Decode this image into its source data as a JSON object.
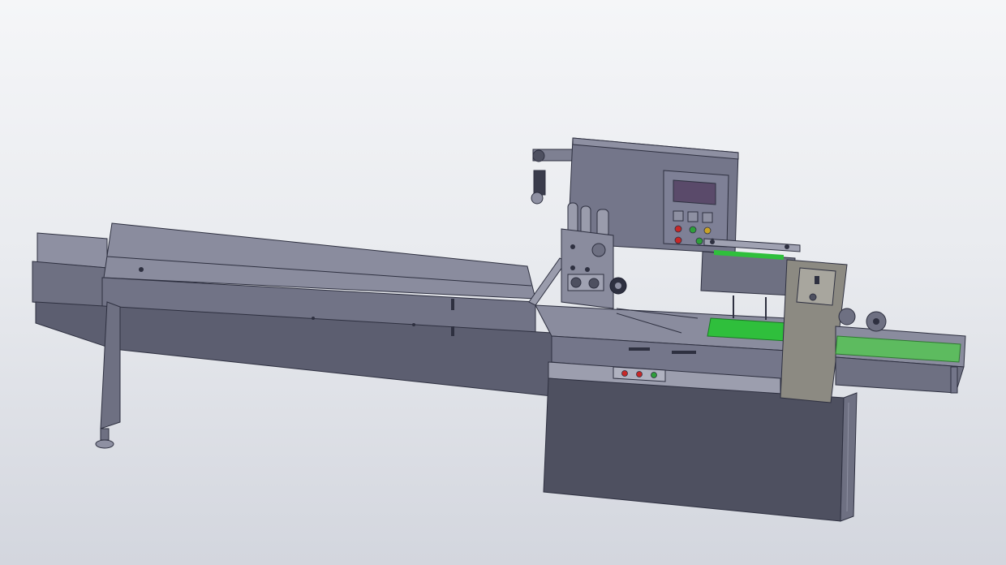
{
  "scene": {
    "subject": "",
    "colors": {
      "background_top": "#f5f6f8",
      "background_bottom": "#d3d6de",
      "body_dark": "#4e5060",
      "body_mid": "#6e7082",
      "body_light": "#8e90a2",
      "edge": "#2e3040",
      "screen": "#5a4a6a",
      "indicator_red": "#c62828",
      "indicator_green": "#2e9e3a",
      "indicator_yellow": "#c9a227",
      "conveyor_green": "#2fbf3c",
      "conveyor_green_light": "#5dbb5f"
    },
    "control_panel": {
      "indicators": [
        "indicator_red",
        "indicator_green",
        "indicator_yellow",
        "indicator_red",
        "indicator_green",
        "indicator_green"
      ]
    },
    "side_panel": {
      "indicators": [
        "indicator_red",
        "indicator_red",
        "indicator_green"
      ]
    }
  }
}
